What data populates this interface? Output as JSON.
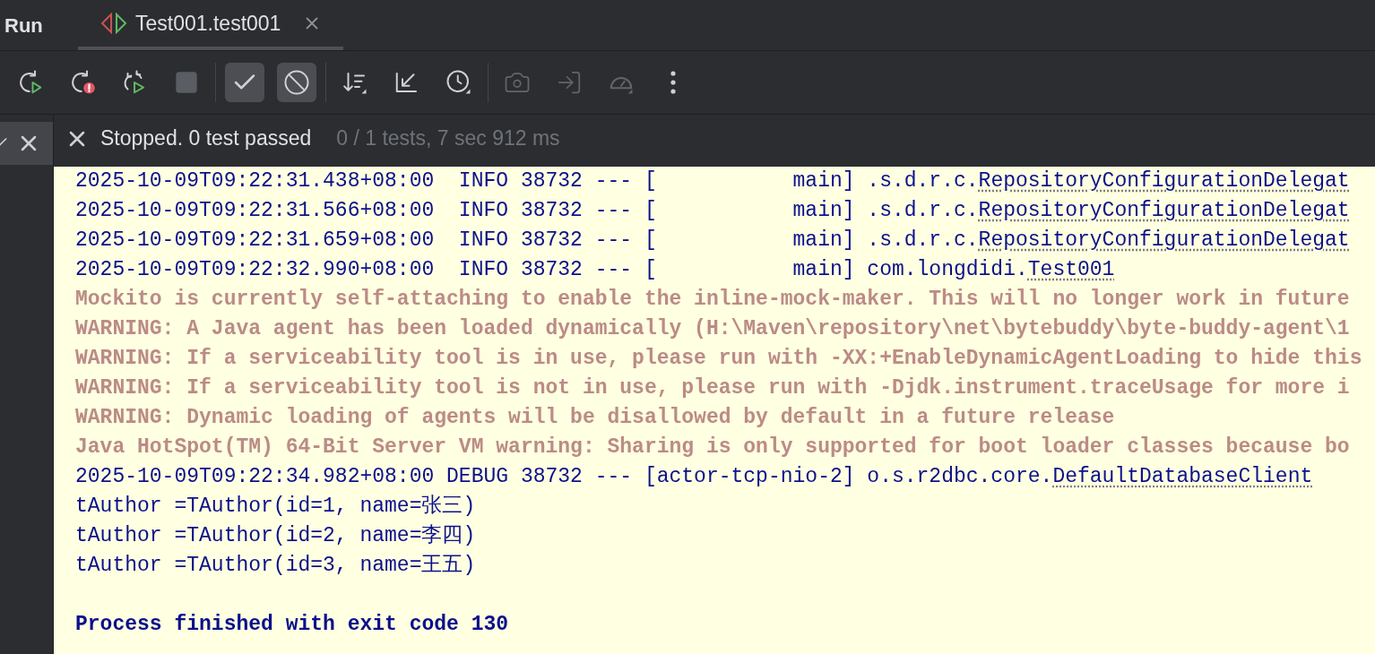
{
  "header": {
    "title": "Run",
    "tabs": [
      {
        "label": "Test001.test001",
        "selected": true
      }
    ]
  },
  "toolbar": {
    "groups": [
      [
        {
          "selected": false,
          "disabled": false
        },
        {
          "selected": false,
          "disabled": false
        },
        {
          "selected": false,
          "disabled": false
        },
        {
          "selected": false,
          "disabled": true
        }
      ],
      [
        {
          "selected": true,
          "disabled": false
        },
        {
          "selected": true,
          "disabled": false
        }
      ],
      [
        {
          "selected": false,
          "disabled": false
        },
        {
          "selected": false,
          "disabled": false
        },
        {
          "selected": false,
          "disabled": false
        }
      ],
      [
        {
          "selected": false,
          "disabled": true
        },
        {
          "selected": false,
          "disabled": true
        },
        {
          "selected": false,
          "disabled": true
        },
        {
          "selected": false,
          "disabled": false
        }
      ]
    ]
  },
  "status": {
    "message": "Stopped. 0 test passed",
    "summary": "0 / 1 tests, 7 sec 912 ms"
  },
  "console": {
    "lines": [
      {
        "kind": "log",
        "segments": [
          {
            "text": "2025-10-09T09:22:31.438+08:00  INFO 38732 --- [           main] .s.d.r.c.",
            "link": false
          },
          {
            "text": "RepositoryConfigurationDelegat",
            "link": true
          }
        ]
      },
      {
        "kind": "log",
        "segments": [
          {
            "text": "2025-10-09T09:22:31.566+08:00  INFO 38732 --- [           main] .s.d.r.c.",
            "link": false
          },
          {
            "text": "RepositoryConfigurationDelegat",
            "link": true
          }
        ]
      },
      {
        "kind": "log",
        "segments": [
          {
            "text": "2025-10-09T09:22:31.659+08:00  INFO 38732 --- [           main] .s.d.r.c.",
            "link": false
          },
          {
            "text": "RepositoryConfigurationDelegat",
            "link": true
          }
        ]
      },
      {
        "kind": "log",
        "segments": [
          {
            "text": "2025-10-09T09:22:32.990+08:00  INFO 38732 --- [           main] com.longdidi.",
            "link": false
          },
          {
            "text": "Test001",
            "link": true
          }
        ]
      },
      {
        "kind": "stderr",
        "segments": [
          {
            "text": "Mockito is currently self-attaching to enable the inline-mock-maker. This will no longer work in future",
            "link": false
          }
        ]
      },
      {
        "kind": "stderr",
        "segments": [
          {
            "text": "WARNING: A Java agent has been loaded dynamically (H:\\Maven\\repository\\net\\bytebuddy\\byte-buddy-agent\\1",
            "link": false
          }
        ]
      },
      {
        "kind": "stderr",
        "segments": [
          {
            "text": "WARNING: If a serviceability tool is in use, please run with -XX:+EnableDynamicAgentLoading to hide this",
            "link": false
          }
        ]
      },
      {
        "kind": "stderr",
        "segments": [
          {
            "text": "WARNING: If a serviceability tool is not in use, please run with -Djdk.instrument.traceUsage for more i",
            "link": false
          }
        ]
      },
      {
        "kind": "stderr",
        "segments": [
          {
            "text": "WARNING: Dynamic loading of agents will be disallowed by default in a future release",
            "link": false
          }
        ]
      },
      {
        "kind": "stderr",
        "segments": [
          {
            "text": "Java HotSpot(TM) 64-Bit Server VM warning: Sharing is only supported for boot loader classes because bo",
            "link": false
          }
        ]
      },
      {
        "kind": "log",
        "segments": [
          {
            "text": "2025-10-09T09:22:34.982+08:00 DEBUG 38732 --- [actor-tcp-nio-2] o.s.r2dbc.core.",
            "link": false
          },
          {
            "text": "DefaultDatabaseClient",
            "link": true
          }
        ]
      },
      {
        "kind": "log",
        "segments": [
          {
            "text": "tAuthor =TAuthor(id=1, name=张三)",
            "link": false
          }
        ]
      },
      {
        "kind": "log",
        "segments": [
          {
            "text": "tAuthor =TAuthor(id=2, name=李四)",
            "link": false
          }
        ]
      },
      {
        "kind": "log",
        "segments": [
          {
            "text": "tAuthor =TAuthor(id=3, name=王五)",
            "link": false
          }
        ]
      },
      {
        "kind": "blank"
      },
      {
        "kind": "exit",
        "segments": [
          {
            "text": "Process finished with exit code 130",
            "link": false
          }
        ]
      }
    ]
  }
}
